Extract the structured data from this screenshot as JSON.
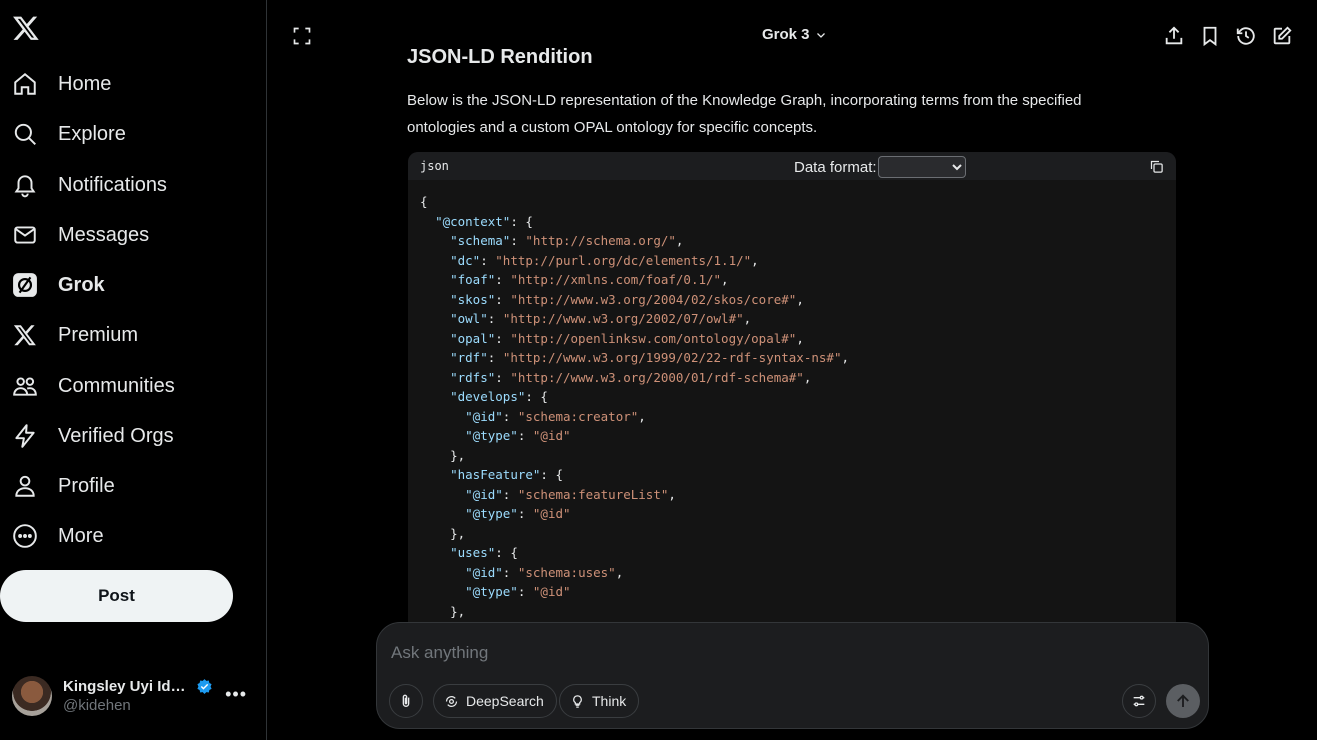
{
  "sidebar": {
    "items": [
      {
        "label": "Home",
        "icon": "home-icon"
      },
      {
        "label": "Explore",
        "icon": "search-icon"
      },
      {
        "label": "Notifications",
        "icon": "bell-icon"
      },
      {
        "label": "Messages",
        "icon": "envelope-icon"
      },
      {
        "label": "Grok",
        "icon": "grok-icon"
      },
      {
        "label": "Premium",
        "icon": "x-logo-icon"
      },
      {
        "label": "Communities",
        "icon": "people-icon"
      },
      {
        "label": "Verified Orgs",
        "icon": "lightning-icon"
      },
      {
        "label": "Profile",
        "icon": "person-icon"
      },
      {
        "label": "More",
        "icon": "more-circle-icon"
      }
    ],
    "post_label": "Post",
    "account": {
      "name": "Kingsley Uyi Ide...",
      "handle": "@kidehen"
    }
  },
  "header": {
    "model": "Grok 3"
  },
  "content": {
    "heading": "JSON-LD Rendition",
    "paragraph": "Below is the JSON-LD representation of the Knowledge Graph, incorporating terms from the specified ontologies and a custom OPAL ontology for specific concepts.",
    "code": {
      "language": "json",
      "format_label": "Data format:",
      "format_value": ""
    }
  },
  "composer": {
    "placeholder": "Ask anything",
    "deepsearch_label": "DeepSearch",
    "think_label": "Think"
  },
  "colors": {
    "accent": "#1d9bf0",
    "code_key": "#9cdcfe",
    "code_string": "#ce9178"
  }
}
